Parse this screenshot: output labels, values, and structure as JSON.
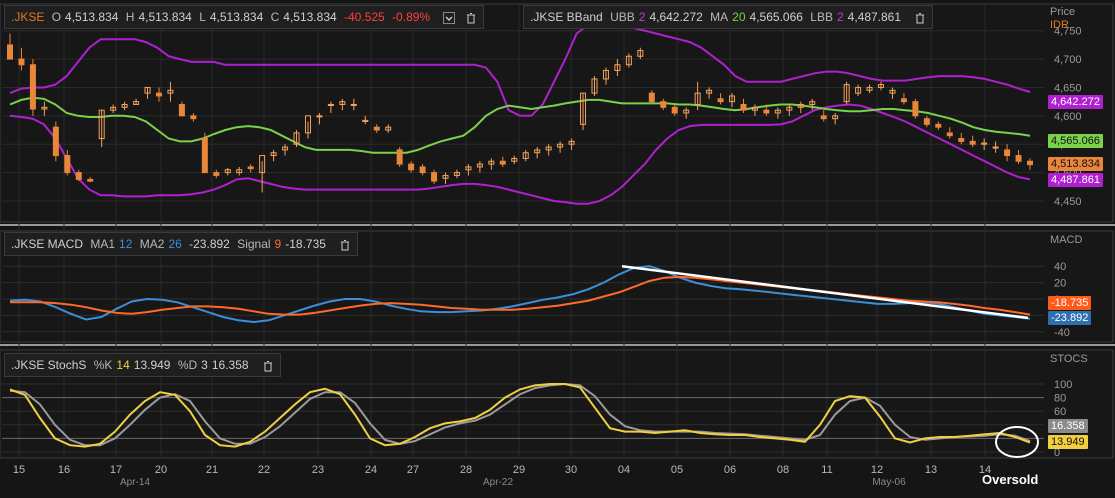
{
  "price_panel": {
    "ohlc": {
      "ticker": ".JKSE",
      "open_label": "O",
      "open": "4,513.834",
      "high_label": "H",
      "high": "4,513.834",
      "low_label": "L",
      "low": "4,513.834",
      "close_label": "C",
      "close": "4,513.834",
      "change": "-40.525",
      "change_pct": "-0.89%"
    },
    "bband": {
      "ticker": ".JKSE BBand",
      "ubb_label": "UBB",
      "ubb_period": "2",
      "ubb_value": "4,642.272",
      "ma_label": "MA",
      "ma_period": "20",
      "ma_value": "4,565.066",
      "lbb_label": "LBB",
      "lbb_period": "2",
      "lbb_value": "4,487.861"
    },
    "axis_title": "Price",
    "currency": "IDR",
    "y_ticks": [
      "4,750",
      "4,700",
      "4,650",
      "4,600",
      "4,550",
      "4,500",
      "4,450"
    ],
    "tags": {
      "ubb": "4,642.272",
      "ma": "4,565.066",
      "close": "4,513.834",
      "lbb": "4,487.861"
    }
  },
  "macd_panel": {
    "ticker": ".JKSE MACD",
    "ma1_label": "MA1",
    "ma1": "12",
    "ma2_label": "MA2",
    "ma2": "26",
    "macd_value": "-23.892",
    "signal_label": "Signal",
    "signal_period": "9",
    "signal_value": "-18.735",
    "axis_title": "MACD",
    "y_ticks": [
      "40",
      "20",
      "0",
      "-20",
      "-40"
    ],
    "tags": {
      "signal": "-18.735",
      "macd": "-23.892"
    }
  },
  "stoch_panel": {
    "ticker": ".JKSE StochS",
    "k_label": "%K",
    "k_period": "14",
    "k_value": "13.949",
    "d_label": "%D",
    "d_period": "3",
    "d_value": "16.358",
    "axis_title": "STOCS",
    "y_ticks": [
      "100",
      "80",
      "60",
      "40",
      "20",
      "0"
    ],
    "tags": {
      "d": "16.358",
      "k": "13.949"
    },
    "annotation": "Oversold"
  },
  "colors": {
    "candle_up": "#f5a25a",
    "candle_down": "#e8863a",
    "upper_band": "#b020d0",
    "ma": "#7ad14a",
    "macd_line": "#3a8fd8",
    "signal_line": "#ff6a2a",
    "stoch_k": "#f0d040",
    "stoch_d": "#9a9a9a",
    "trendline": "#ffffff"
  },
  "chart_data": [
    {
      "type": "candlestick",
      "title": ".JKSE",
      "ylabel": "Price IDR",
      "ylim": [
        4420,
        4790
      ],
      "x_dates": [
        "Apr-14",
        "Apr-15",
        "Apr-16",
        "Apr-17",
        "Apr-20",
        "Apr-21",
        "Apr-22",
        "Apr-23",
        "Apr-24",
        "Apr-27",
        "Apr-28",
        "Apr-29",
        "Apr-30",
        "May-04",
        "May-05",
        "May-06",
        "May-08",
        "May-11",
        "May-12",
        "May-13",
        "May-14"
      ],
      "x_tick_labels": [
        "15",
        "16",
        "17",
        "20",
        "21",
        "22",
        "23",
        "24",
        "27",
        "28",
        "29",
        "30",
        "04",
        "05",
        "06",
        "08",
        "11",
        "12",
        "13",
        "14"
      ],
      "x_month_labels": [
        "Apr-14",
        "Apr-22",
        "May-06"
      ],
      "candles": [
        [
          4725,
          4745,
          4700,
          4700
        ],
        [
          4700,
          4720,
          4680,
          4690
        ],
        [
          4690,
          4700,
          4600,
          4612
        ],
        [
          4612,
          4625,
          4600,
          4615
        ],
        [
          4580,
          4590,
          4520,
          4530
        ],
        [
          4530,
          4540,
          4495,
          4500
        ],
        [
          4500,
          4505,
          4485,
          4488
        ],
        [
          4488,
          4492,
          4483,
          4485
        ],
        [
          4560,
          4610,
          4545,
          4610
        ],
        [
          4610,
          4620,
          4605,
          4615
        ],
        [
          4615,
          4625,
          4610,
          4620
        ],
        [
          4620,
          4630,
          4620,
          4625
        ],
        [
          4640,
          4650,
          4630,
          4650
        ],
        [
          4640,
          4650,
          4625,
          4635
        ],
        [
          4640,
          4660,
          4625,
          4645
        ],
        [
          4620,
          4625,
          4610,
          4600
        ],
        [
          4600,
          4605,
          4590,
          4595
        ],
        [
          4560,
          4570,
          4500,
          4500
        ],
        [
          4500,
          4505,
          4490,
          4495
        ],
        [
          4500,
          4508,
          4495,
          4505
        ],
        [
          4500,
          4510,
          4495,
          4505
        ],
        [
          4510,
          4515,
          4500,
          4507
        ],
        [
          4500,
          4520,
          4465,
          4530
        ],
        [
          4530,
          4540,
          4520,
          4535
        ],
        [
          4540,
          4550,
          4530,
          4545
        ],
        [
          4550,
          4575,
          4545,
          4570
        ],
        [
          4570,
          4590,
          4560,
          4600
        ],
        [
          4600,
          4605,
          4585,
          4600
        ],
        [
          4620,
          4625,
          4605,
          4620
        ],
        [
          4620,
          4630,
          4610,
          4625
        ],
        [
          4620,
          4630,
          4610,
          4620
        ],
        [
          4590,
          4600,
          4585,
          4592
        ],
        [
          4580,
          4585,
          4570,
          4575
        ],
        [
          4575,
          4585,
          4570,
          4580
        ],
        [
          4540,
          4545,
          4510,
          4515
        ],
        [
          4515,
          4520,
          4500,
          4505
        ],
        [
          4510,
          4515,
          4495,
          4500
        ],
        [
          4500,
          4505,
          4480,
          4485
        ],
        [
          4490,
          4500,
          4480,
          4495
        ],
        [
          4495,
          4505,
          4490,
          4500
        ],
        [
          4505,
          4515,
          4495,
          4510
        ],
        [
          4510,
          4520,
          4500,
          4515
        ],
        [
          4515,
          4525,
          4505,
          4520
        ],
        [
          4520,
          4528,
          4510,
          4515
        ],
        [
          4520,
          4530,
          4515,
          4525
        ],
        [
          4525,
          4540,
          4520,
          4535
        ],
        [
          4535,
          4545,
          4525,
          4540
        ],
        [
          4540,
          4550,
          4530,
          4545
        ],
        [
          4545,
          4555,
          4535,
          4550
        ],
        [
          4550,
          4560,
          4540,
          4555
        ],
        [
          4585,
          4640,
          4575,
          4640
        ],
        [
          4640,
          4670,
          4635,
          4665
        ],
        [
          4665,
          4685,
          4655,
          4680
        ],
        [
          4680,
          4700,
          4670,
          4690
        ],
        [
          4690,
          4710,
          4685,
          4705
        ],
        [
          4705,
          4720,
          4700,
          4715
        ],
        [
          4640,
          4645,
          4620,
          4625
        ],
        [
          4625,
          4630,
          4610,
          4615
        ],
        [
          4615,
          4620,
          4600,
          4605
        ],
        [
          4605,
          4615,
          4595,
          4610
        ],
        [
          4620,
          4660,
          4610,
          4640
        ],
        [
          4640,
          4650,
          4630,
          4645
        ],
        [
          4630,
          4640,
          4620,
          4625
        ],
        [
          4625,
          4640,
          4615,
          4635
        ],
        [
          4620,
          4630,
          4605,
          4610
        ],
        [
          4610,
          4620,
          4600,
          4615
        ],
        [
          4610,
          4620,
          4600,
          4605
        ],
        [
          4605,
          4615,
          4595,
          4610
        ],
        [
          4610,
          4620,
          4600,
          4615
        ],
        [
          4615,
          4625,
          4605,
          4620
        ],
        [
          4620,
          4630,
          4610,
          4625
        ],
        [
          4600,
          4610,
          4590,
          4595
        ],
        [
          4595,
          4605,
          4585,
          4600
        ],
        [
          4625,
          4660,
          4620,
          4655
        ],
        [
          4640,
          4655,
          4635,
          4650
        ],
        [
          4645,
          4655,
          4640,
          4650
        ],
        [
          4650,
          4660,
          4645,
          4655
        ],
        [
          4640,
          4650,
          4630,
          4645
        ],
        [
          4630,
          4640,
          4620,
          4625
        ],
        [
          4625,
          4630,
          4595,
          4600
        ],
        [
          4595,
          4600,
          4580,
          4585
        ],
        [
          4585,
          4590,
          4575,
          4580
        ],
        [
          4570,
          4580,
          4560,
          4565
        ],
        [
          4560,
          4570,
          4550,
          4555
        ],
        [
          4555,
          4565,
          4545,
          4550
        ],
        [
          4550,
          4560,
          4540,
          4552
        ],
        [
          4545,
          4555,
          4535,
          4545
        ],
        [
          4540,
          4550,
          4520,
          4530
        ],
        [
          4530,
          4540,
          4515,
          4520
        ],
        [
          4520,
          4525,
          4505,
          4514
        ]
      ],
      "upper_band": [
        4640,
        4648,
        4650,
        4650,
        4655,
        4670,
        4695,
        4720,
        4735,
        4735,
        4735,
        4735,
        4730,
        4720,
        4705,
        4700,
        4695,
        4695,
        4695,
        4690,
        4690,
        4690,
        4690,
        4690,
        4690,
        4690,
        4690,
        4690,
        4690,
        4690,
        4690,
        4690,
        4690,
        4690,
        4690,
        4690,
        4690,
        4690,
        4690,
        4690,
        4690,
        4690,
        4685,
        4660,
        4610,
        4600,
        4600,
        4620,
        4660,
        4700,
        4745,
        4760,
        4765,
        4765,
        4760,
        4755,
        4750,
        4745,
        4740,
        4735,
        4730,
        4720,
        4705,
        4690,
        4670,
        4660,
        4660,
        4660,
        4660,
        4665,
        4670,
        4675,
        4678,
        4678,
        4675,
        4670,
        4665,
        4662,
        4662,
        4662,
        4665,
        4668,
        4670,
        4670,
        4670,
        4668,
        4665,
        4660,
        4655,
        4648,
        4642
      ],
      "ma": [
        4620,
        4628,
        4632,
        4630,
        4620,
        4605,
        4600,
        4598,
        4598,
        4600,
        4600,
        4598,
        4590,
        4575,
        4560,
        4555,
        4555,
        4560,
        4568,
        4575,
        4580,
        4582,
        4580,
        4575,
        4565,
        4555,
        4545,
        4540,
        4540,
        4540,
        4540,
        4538,
        4535,
        4535,
        4535,
        4535,
        4540,
        4548,
        4555,
        4560,
        4565,
        4580,
        4600,
        4612,
        4618,
        4615,
        4612,
        4615,
        4618,
        4622,
        4625,
        4628,
        4628,
        4625,
        4622,
        4622,
        4622,
        4622,
        4622,
        4620,
        4620,
        4618,
        4615,
        4612,
        4610,
        4612,
        4615,
        4618,
        4620,
        4620,
        4618,
        4615,
        4612,
        4610,
        4608,
        4608,
        4610,
        4612,
        4612,
        4610,
        4608,
        4605,
        4600,
        4595,
        4588,
        4580,
        4575,
        4572,
        4570,
        4568,
        4565
      ],
      "lower_band": [
        4600,
        4598,
        4595,
        4585,
        4560,
        4525,
        4490,
        4470,
        4460,
        4460,
        4458,
        4458,
        4458,
        4460,
        4460,
        4460,
        4462,
        4465,
        4470,
        4478,
        4488,
        4490,
        4485,
        4480,
        4475,
        4472,
        4470,
        4470,
        4470,
        4470,
        4470,
        4470,
        4470,
        4470,
        4470,
        4470,
        4470,
        4472,
        4475,
        4478,
        4480,
        4480,
        4478,
        4475,
        4470,
        4465,
        4460,
        4455,
        4450,
        4448,
        4445,
        4445,
        4450,
        4460,
        4475,
        4495,
        4515,
        4540,
        4560,
        4575,
        4582,
        4584,
        4584,
        4584,
        4584,
        4584,
        4584,
        4584,
        4585,
        4590,
        4600,
        4610,
        4615,
        4618,
        4620,
        4618,
        4612,
        4605,
        4598,
        4590,
        4580,
        4570,
        4560,
        4550,
        4540,
        4530,
        4520,
        4510,
        4500,
        4492,
        4488
      ]
    },
    {
      "type": "line",
      "title": ".JKSE MACD",
      "ylim": [
        -50,
        50
      ],
      "series": [
        {
          "name": "MACD",
          "values": [
            -2,
            -1,
            -3,
            -10,
            -18,
            -25,
            -22,
            -12,
            -3,
            0,
            -1,
            -4,
            -10,
            -16,
            -22,
            -26,
            -28,
            -26,
            -20,
            -14,
            -8,
            -3,
            0,
            0,
            -3,
            -8,
            -12,
            -15,
            -16,
            -16,
            -15,
            -14,
            -12,
            -9,
            -5,
            -1,
            2,
            6,
            12,
            20,
            30,
            38,
            40,
            34,
            26,
            20,
            16,
            13,
            12,
            10,
            8,
            6,
            4,
            2,
            0,
            -2,
            -4,
            -6,
            -6,
            -5,
            -4,
            -6,
            -10,
            -14,
            -18,
            -20,
            -22,
            -24
          ]
        },
        {
          "name": "Signal",
          "values": [
            -4,
            -4,
            -4,
            -5,
            -7,
            -10,
            -14,
            -17,
            -18,
            -16,
            -13,
            -11,
            -9,
            -9,
            -10,
            -12,
            -15,
            -18,
            -19,
            -19,
            -17,
            -14,
            -11,
            -8,
            -6,
            -5,
            -6,
            -7,
            -9,
            -11,
            -12,
            -13,
            -13,
            -13,
            -12,
            -10,
            -8,
            -5,
            -2,
            3,
            8,
            15,
            22,
            26,
            27,
            26,
            24,
            22,
            20,
            18,
            16,
            14,
            12,
            10,
            8,
            6,
            4,
            2,
            0,
            -2,
            -3,
            -4,
            -6,
            -8,
            -11,
            -13,
            -16,
            -19
          ]
        }
      ],
      "annotations": [
        "trendline"
      ]
    },
    {
      "type": "line",
      "title": ".JKSE StochS",
      "ylim": [
        0,
        100
      ],
      "series": [
        {
          "name": "%K",
          "values": [
            92,
            84,
            50,
            20,
            10,
            8,
            12,
            30,
            55,
            75,
            88,
            84,
            60,
            25,
            10,
            8,
            15,
            30,
            50,
            70,
            88,
            93,
            85,
            55,
            20,
            10,
            12,
            22,
            35,
            42,
            45,
            50,
            62,
            80,
            92,
            98,
            100,
            100,
            95,
            65,
            35,
            30,
            30,
            28,
            30,
            32,
            28,
            26,
            25,
            25,
            22,
            20,
            18,
            15,
            40,
            75,
            82,
            80,
            52,
            20,
            14,
            20,
            22,
            22,
            24,
            26,
            28,
            22,
            14
          ]
        },
        {
          "name": "%D",
          "values": [
            90,
            88,
            70,
            40,
            18,
            10,
            10,
            20,
            40,
            62,
            80,
            85,
            75,
            45,
            20,
            12,
            12,
            22,
            38,
            58,
            78,
            88,
            88,
            72,
            42,
            18,
            12,
            16,
            26,
            36,
            42,
            46,
            55,
            70,
            85,
            94,
            98,
            100,
            98,
            82,
            55,
            38,
            32,
            30,
            30,
            30,
            30,
            28,
            27,
            26,
            24,
            22,
            20,
            18,
            25,
            55,
            75,
            80,
            68,
            40,
            22,
            18,
            20,
            22,
            23,
            24,
            26,
            24,
            16
          ]
        }
      ],
      "annotations": [
        "Oversold"
      ]
    }
  ]
}
